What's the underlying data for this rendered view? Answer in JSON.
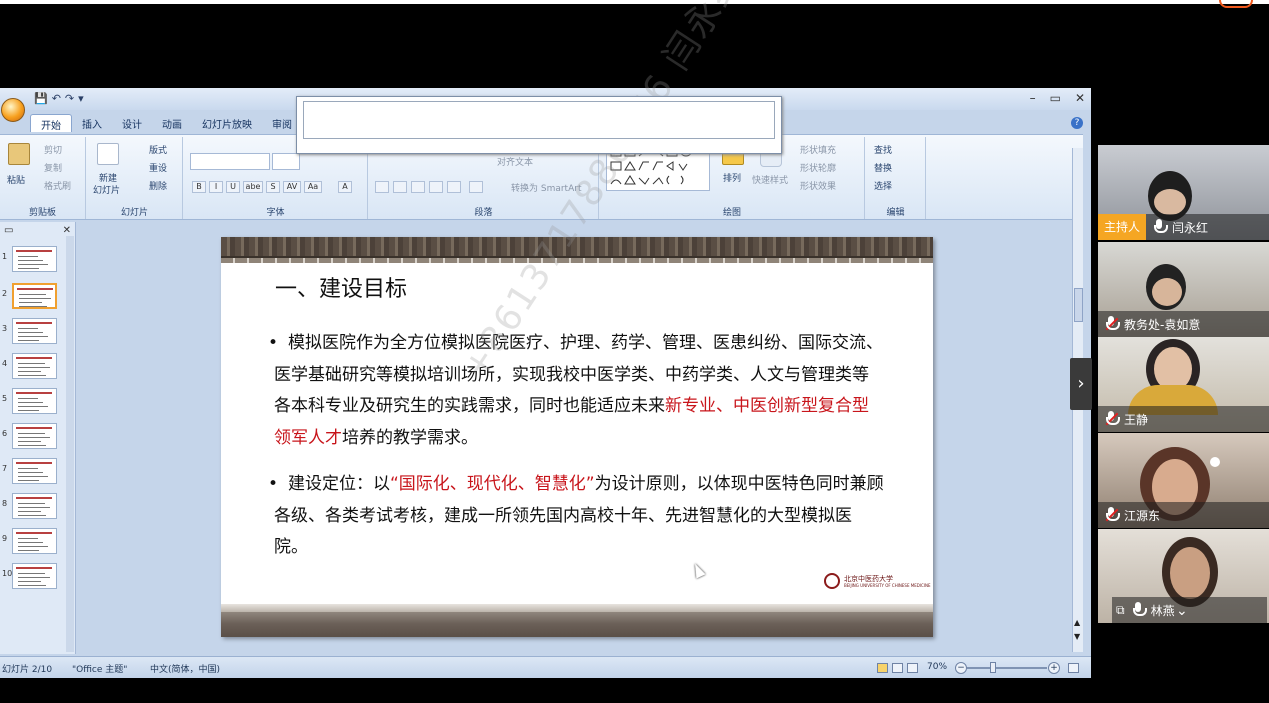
{
  "ppt": {
    "quick_access": [
      "💾",
      "↶",
      "↷",
      "▾"
    ],
    "window_controls": [
      "–",
      "▭",
      "✕"
    ],
    "tabs": [
      "开始",
      "插入",
      "设计",
      "动画",
      "幻灯片放映",
      "审阅"
    ],
    "ribbon": {
      "clipboard": {
        "paste": "粘贴",
        "cut": "剪切",
        "copy": "复制",
        "format_painter": "格式刷",
        "label": "剪贴板"
      },
      "slides": {
        "new_slide": "新建",
        "new_slide2": "幻灯片",
        "layout": "版式",
        "reset": "重设",
        "delete": "删除",
        "label": "幻灯片"
      },
      "font": {
        "label": "字体",
        "format_buttons": [
          "B",
          "I",
          "U",
          "abe",
          "S",
          "AV",
          "Aa",
          "A"
        ]
      },
      "paragraph": {
        "text_direction": "对齐文本",
        "smartart": "转换为 SmartArt",
        "label": "段落"
      },
      "drawing": {
        "arrange": "排列",
        "quick_styles": "快速样式",
        "shape_fill": "形状填充",
        "shape_outline": "形状轮廓",
        "shape_effects": "形状效果",
        "label": "绘图"
      },
      "editing": {
        "find": "查找",
        "replace": "替换",
        "select": "选择",
        "label": "编辑"
      }
    },
    "thumbnails": [
      "1",
      "2",
      "3",
      "4",
      "5",
      "6",
      "7",
      "8",
      "9",
      "10"
    ],
    "slide": {
      "title": "一、建设目标",
      "bullet1_pre": "模拟医院作为全方位模拟医院医疗、护理、药学、管理、医患纠纷、国际交流、医学基础研究等模拟培训场所，实现我校中医学类、中药学类、人文与管理类等各本科专业及研究生的实践需求，同时也能适应未来",
      "bullet1_red": "新专业、中医创新型复合型领军人才",
      "bullet1_post": "培养的教学需求。",
      "bullet2_pre": "建设定位：以",
      "bullet2_red": "“国际化、现代化、智慧化”",
      "bullet2_post": "为设计原则，以体现中医特色同时兼顾各级、各类考试考核，建成一所领先国内高校十年、先进智慧化的大型模拟医院。",
      "logo_cn": "北京中医药大学",
      "logo_en": "BEIJING UNIVERSITY OF CHINESE MEDICINE",
      "watermark": "+8613717886376 闫永红"
    },
    "status": {
      "slide_no": "幻灯片 2/10",
      "theme": "\"Office 主题\"",
      "language": "中文(简体，中国)",
      "zoom": "70%"
    }
  },
  "participants": [
    {
      "name": "闫永红",
      "role": "主持人",
      "mic": "on"
    },
    {
      "name": "教务处-袁如意",
      "role": "",
      "mic": "off"
    },
    {
      "name": "王静",
      "role": "",
      "mic": "off"
    },
    {
      "name": "江源东",
      "role": "",
      "mic": "off"
    },
    {
      "name": "林燕",
      "role": "",
      "mic": "on"
    }
  ],
  "colors": {
    "accent_red": "#c8151b",
    "host_badge": "#f5a623"
  }
}
